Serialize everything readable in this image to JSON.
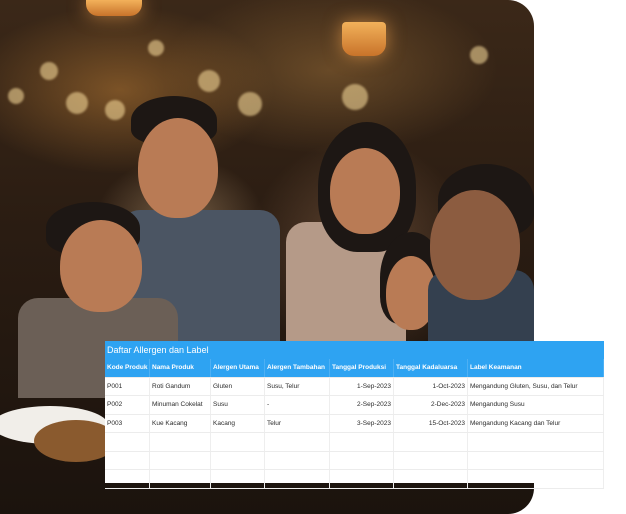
{
  "photo": {
    "description_icon": "family-restaurant-photo"
  },
  "table": {
    "title": "Daftar Allergen dan Label",
    "columns": [
      "Kode Produk",
      "Nama Produk",
      "Alergen Utama",
      "Alergen Tambahan",
      "Tanggal Produksi",
      "Tanggal Kadaluarsa",
      "Label Keamanan"
    ],
    "rows": [
      [
        "P001",
        "Roti Gandum",
        "Gluten",
        "Susu, Telur",
        "1-Sep-2023",
        "1-Oct-2023",
        "Mengandung Gluten, Susu, dan Telur"
      ],
      [
        "P002",
        "Minuman Cokelat",
        "Susu",
        "-",
        "2-Sep-2023",
        "2-Dec-2023",
        "Mengandung Susu"
      ],
      [
        "P003",
        "Kue Kacang",
        "Kacang",
        "Telur",
        "3-Sep-2023",
        "15-Oct-2023",
        "Mengandung Kacang dan Telur"
      ]
    ],
    "empty_rows": 3,
    "colors": {
      "header": "#2ea3f2",
      "header_text": "#ffffff"
    }
  }
}
